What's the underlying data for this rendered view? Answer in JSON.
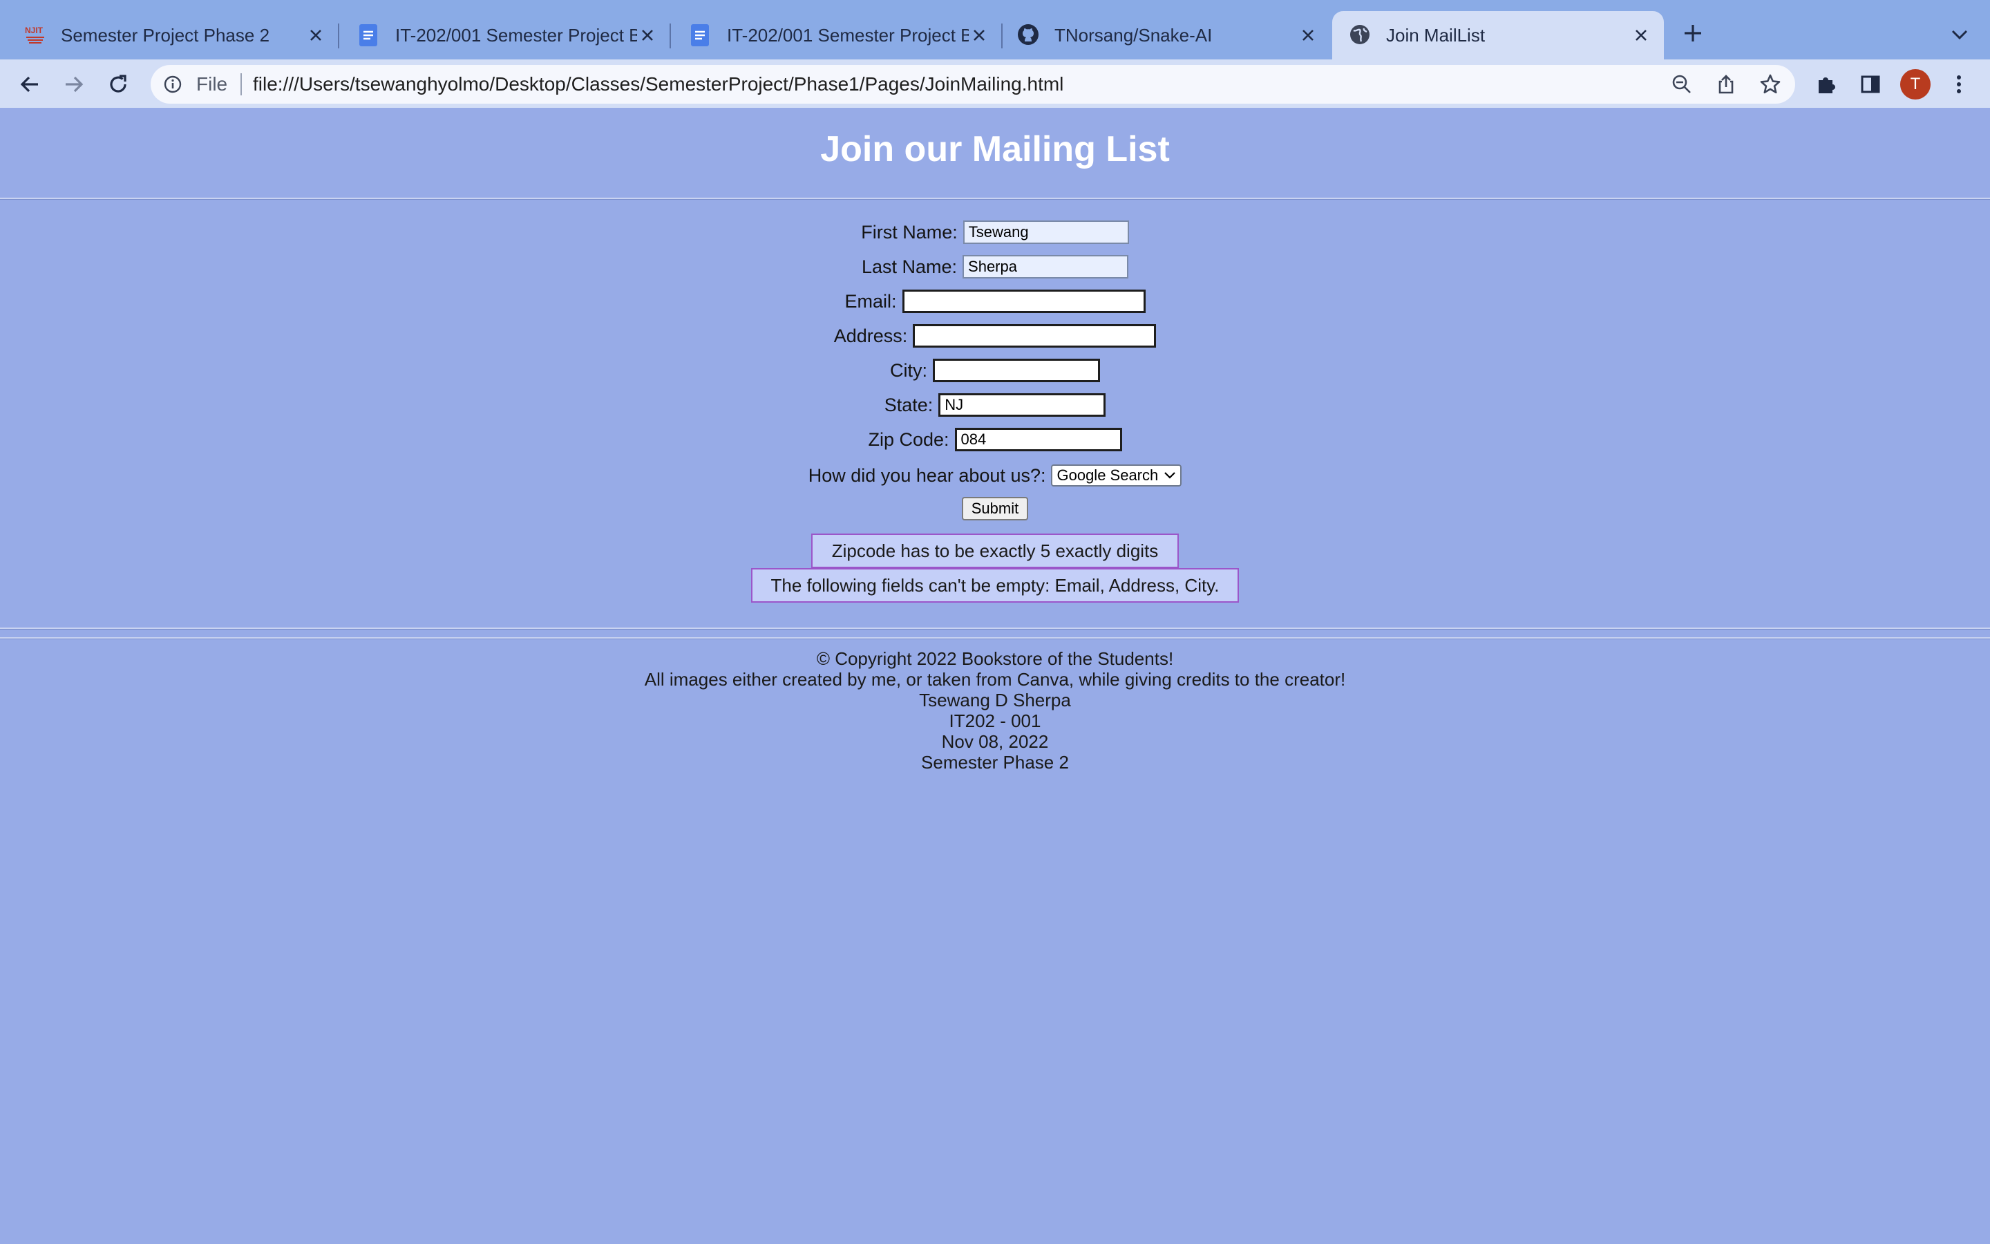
{
  "browser": {
    "tabs": [
      {
        "title": "Semester Project Phase 2",
        "icon": "njit-logo-icon"
      },
      {
        "title": "IT-202/001 Semester Project B",
        "icon": "google-docs-icon"
      },
      {
        "title": "IT-202/001 Semester Project B",
        "icon": "google-docs-icon"
      },
      {
        "title": "TNorsang/Snake-AI",
        "icon": "github-icon"
      },
      {
        "title": "Join MailList",
        "icon": "globe-icon",
        "active": true
      }
    ],
    "address_scheme": "File",
    "address_url": "file:///Users/tsewanghyolmo/Desktop/Classes/SemesterProject/Phase1/Pages/JoinMailing.html",
    "profile_initial": "T",
    "colors": {
      "tabstrip": "#8aabe6",
      "toolbar": "#d3def6",
      "avatar": "#b83b1f"
    }
  },
  "page": {
    "background": "#97abe7",
    "heading": "Join our Mailing List",
    "form": {
      "first_name": {
        "label": "First Name:",
        "value": "Tsewang"
      },
      "last_name": {
        "label": "Last Name:",
        "value": "Sherpa"
      },
      "email": {
        "label": "Email:",
        "value": ""
      },
      "address": {
        "label": "Address:",
        "value": ""
      },
      "city": {
        "label": "City:",
        "value": ""
      },
      "state": {
        "label": "State:",
        "value": "NJ"
      },
      "zip": {
        "label": "Zip Code:",
        "value": "084"
      },
      "referral": {
        "label": "How did you hear about us?:",
        "selected": "Google Search"
      },
      "submit_label": "Submit"
    },
    "errors": [
      "Zipcode has to be exactly 5 exactly digits",
      "The following fields can't be empty: Email, Address, City."
    ],
    "footer": {
      "copyright": "© Copyright 2022 Bookstore of the Students!",
      "credits": "All images either created by me, or taken from Canva, while giving credits to the creator!",
      "author": "Tsewang D Sherpa",
      "course": "IT202 - 001",
      "date": "Nov 08, 2022",
      "phase": "Semester Phase 2"
    }
  }
}
